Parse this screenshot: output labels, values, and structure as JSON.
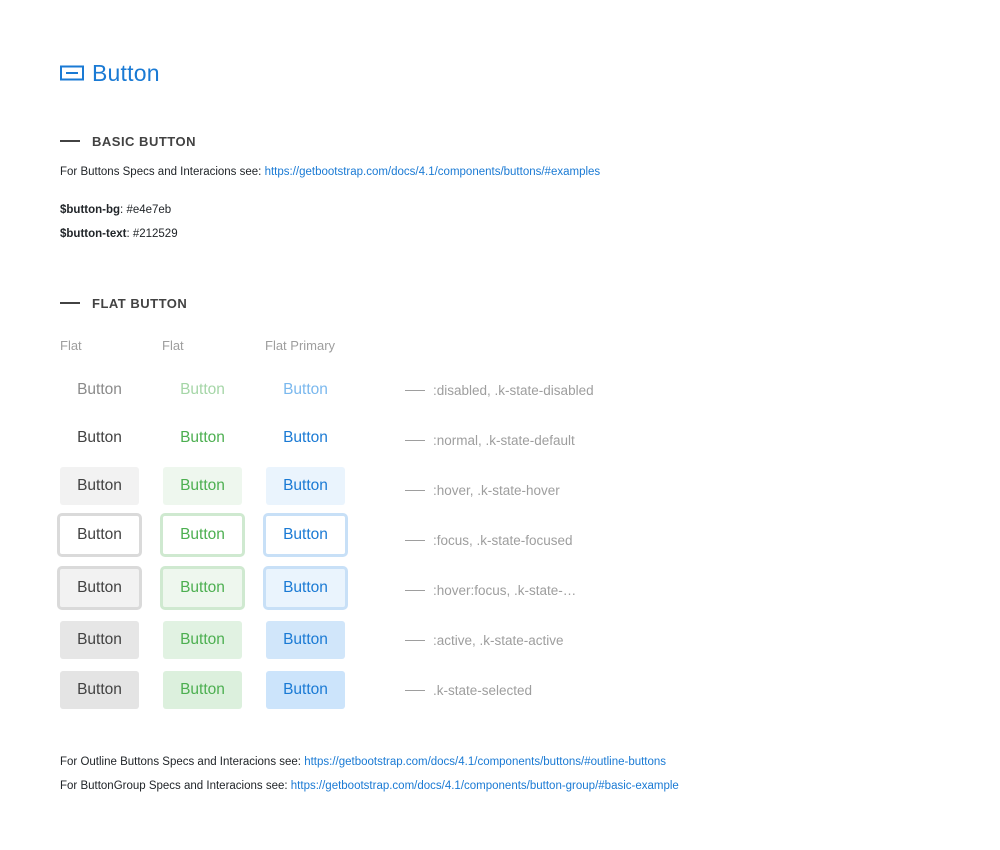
{
  "page": {
    "title": "Button",
    "title_icon": "button-icon"
  },
  "basic": {
    "heading": "BASIC BUTTON",
    "specs_prefix": "For Buttons Specs and Interacions see: ",
    "specs_link": "https://getbootstrap.com/docs/4.1/components/buttons/#examples",
    "vars": [
      {
        "name": "$button-bg",
        "sep": ": ",
        "value": "#e4e7eb"
      },
      {
        "name": "$button-text",
        "sep": ": ",
        "value": "#212529"
      }
    ]
  },
  "flat": {
    "heading": "FLAT BUTTON",
    "columns": [
      "Flat",
      "Flat",
      "Flat Primary"
    ],
    "button_label": "Button",
    "states": [
      ":disabled, .k-state-disabled",
      ":normal, .k-state-default",
      ":hover, .k-state-hover",
      ":focus, .k-state-focused",
      ":hover:focus, .k-state-…",
      ":active, .k-state-active",
      ".k-state-selected"
    ],
    "colors": {
      "default_text": "#424242",
      "success_text": "#4caf50",
      "primary_text": "#1a7ad4"
    }
  },
  "footer": {
    "outline_prefix": "For Outline Buttons Specs and Interacions see: ",
    "outline_link": "https://getbootstrap.com/docs/4.1/components/buttons/#outline-buttons",
    "group_prefix": "For ButtonGroup Specs and Interacions see: ",
    "group_link": "https://getbootstrap.com/docs/4.1/components/button-group/#basic-example"
  }
}
